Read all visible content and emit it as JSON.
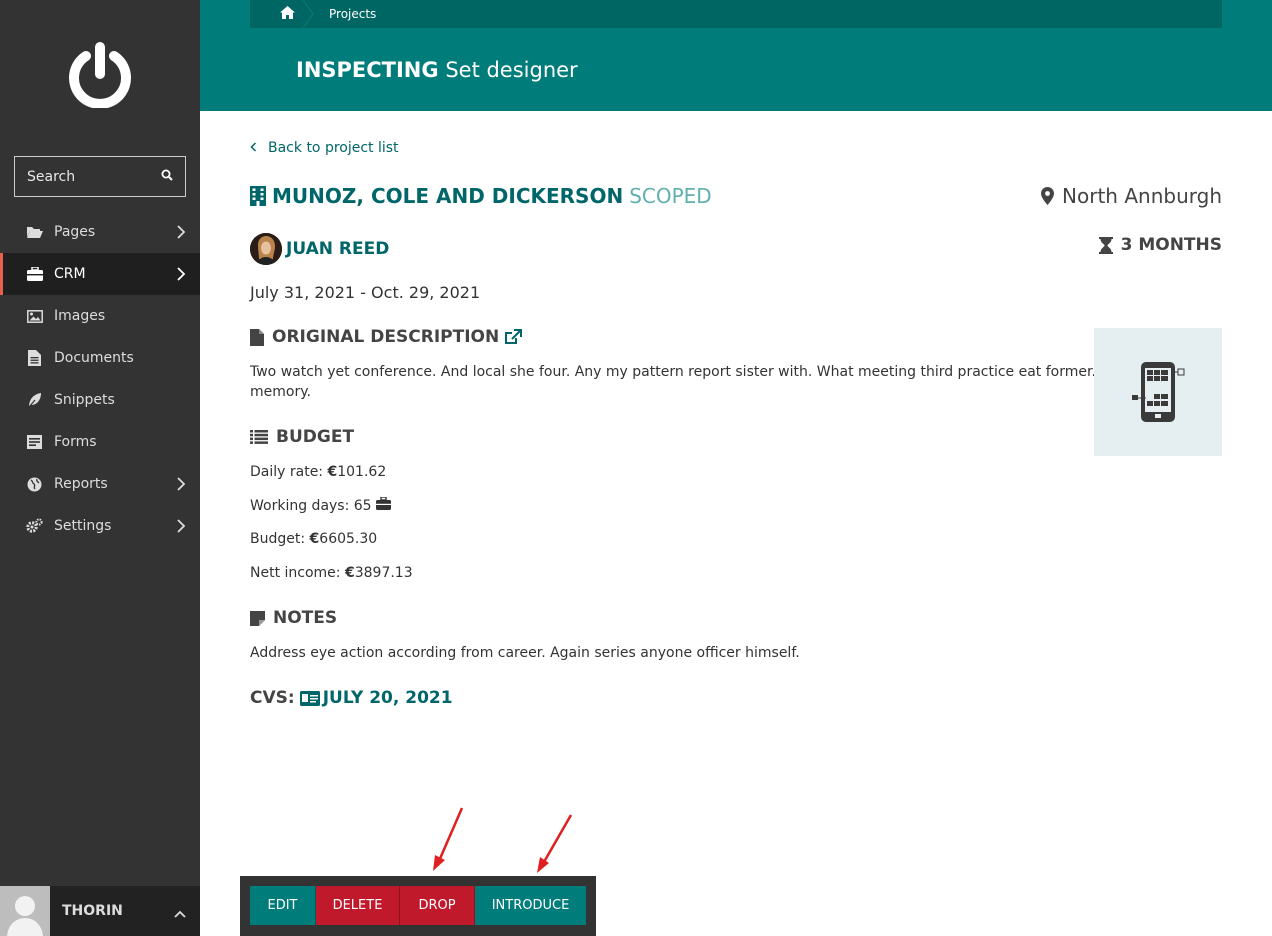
{
  "sidebar": {
    "search_placeholder": "Search",
    "items": [
      {
        "label": "Pages",
        "icon": "folder-open-icon",
        "has_children": true
      },
      {
        "label": "CRM",
        "icon": "briefcase-icon",
        "has_children": true,
        "active": true
      },
      {
        "label": "Images",
        "icon": "image-icon",
        "has_children": false
      },
      {
        "label": "Documents",
        "icon": "file-text-icon",
        "has_children": false
      },
      {
        "label": "Snippets",
        "icon": "leaf-icon",
        "has_children": false
      },
      {
        "label": "Forms",
        "icon": "form-icon",
        "has_children": false
      },
      {
        "label": "Reports",
        "icon": "globe-icon",
        "has_children": true
      },
      {
        "label": "Settings",
        "icon": "cogs-icon",
        "has_children": true
      }
    ],
    "user": {
      "name": "THORIN"
    }
  },
  "header": {
    "breadcrumb": {
      "home_icon": "home-icon",
      "current": "Projects"
    },
    "title_prefix": "INSPECTING",
    "title_suffix": "Set designer"
  },
  "project": {
    "back_label": "Back to project list",
    "company": "MUNOZ, COLE AND DICKERSON",
    "status": "SCOPED",
    "location": "North Annburgh",
    "person": "JUAN REED",
    "duration": "3 MONTHS",
    "dates": "July 31, 2021 - Oct. 29, 2021",
    "description_heading": "ORIGINAL DESCRIPTION",
    "description": "Two watch yet conference. And local she four. Any my pattern report sister with. What meeting third practice eat former. Can TV deep",
    "description_line2": "memory.",
    "budget_heading": "BUDGET",
    "daily_rate_label": "Daily rate:",
    "daily_rate": "101.62",
    "working_days_label": "Working days:",
    "working_days": "65",
    "budget_label": "Budget:",
    "budget": "6605.30",
    "nett_income_label": "Nett income:",
    "nett_income": "3897.13",
    "currency": "€",
    "notes_heading": "NOTES",
    "notes": "Address eye action according from career. Again series anyone officer himself.",
    "cvs_label": "CVS:",
    "cvs_date": "JULY 20, 2021"
  },
  "actions": {
    "edit": "EDIT",
    "delete": "DELETE",
    "drop": "DROP",
    "introduce": "INTRODUCE"
  },
  "colors": {
    "teal": "#007c7a",
    "dark_teal": "#006664",
    "red": "#c0192b",
    "sidebar": "#333333",
    "annotation_arrow": "#e02020"
  }
}
